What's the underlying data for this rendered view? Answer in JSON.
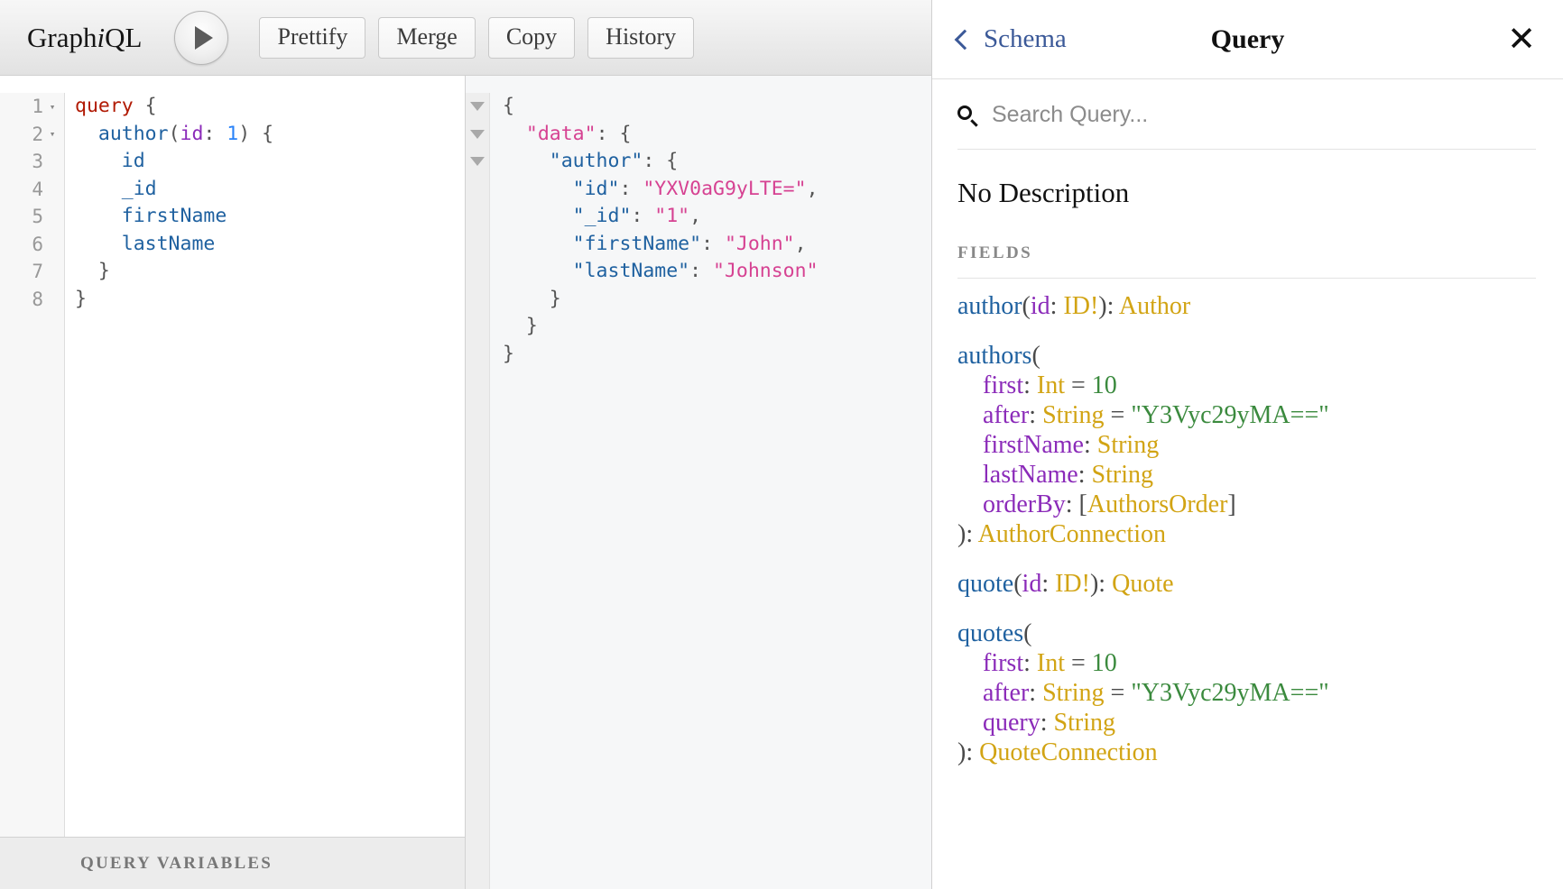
{
  "toolbar": {
    "logo_prefix": "Graph",
    "logo_i": "i",
    "logo_suffix": "QL",
    "execute_label": "▶",
    "buttons": [
      "Prettify",
      "Merge",
      "Copy",
      "History"
    ]
  },
  "query_editor": {
    "lines": [
      {
        "num": "1",
        "fold": "▾",
        "segments": [
          {
            "text": "query",
            "cls": "tok-kw"
          },
          {
            "text": " {",
            "cls": "tok-punc"
          }
        ]
      },
      {
        "num": "2",
        "fold": "▾",
        "segments": [
          {
            "text": "  ",
            "cls": "tok-punc"
          },
          {
            "text": "author",
            "cls": "tok-field"
          },
          {
            "text": "(",
            "cls": "tok-punc"
          },
          {
            "text": "id",
            "cls": "tok-arg"
          },
          {
            "text": ": ",
            "cls": "tok-punc"
          },
          {
            "text": "1",
            "cls": "tok-num"
          },
          {
            "text": ") {",
            "cls": "tok-punc"
          }
        ]
      },
      {
        "num": "3",
        "fold": "",
        "segments": [
          {
            "text": "    ",
            "cls": "tok-punc"
          },
          {
            "text": "id",
            "cls": "tok-field"
          }
        ]
      },
      {
        "num": "4",
        "fold": "",
        "segments": [
          {
            "text": "    ",
            "cls": "tok-punc"
          },
          {
            "text": "_id",
            "cls": "tok-field"
          }
        ]
      },
      {
        "num": "5",
        "fold": "",
        "segments": [
          {
            "text": "    ",
            "cls": "tok-punc"
          },
          {
            "text": "firstName",
            "cls": "tok-field"
          }
        ]
      },
      {
        "num": "6",
        "fold": "",
        "segments": [
          {
            "text": "    ",
            "cls": "tok-punc"
          },
          {
            "text": "lastName",
            "cls": "tok-field"
          }
        ]
      },
      {
        "num": "7",
        "fold": "",
        "segments": [
          {
            "text": "  }",
            "cls": "tok-punc"
          }
        ]
      },
      {
        "num": "8",
        "fold": "",
        "segments": [
          {
            "text": "}",
            "cls": "tok-punc"
          }
        ]
      }
    ],
    "query_variables_label": "QUERY VARIABLES"
  },
  "result": {
    "fold_count": 3,
    "lines": [
      [
        {
          "text": "{",
          "cls": "j-punc"
        }
      ],
      [
        {
          "text": "  ",
          "cls": "j-punc"
        },
        {
          "text": "\"data\"",
          "cls": "j-key-top"
        },
        {
          "text": ": {",
          "cls": "j-punc"
        }
      ],
      [
        {
          "text": "    ",
          "cls": "j-punc"
        },
        {
          "text": "\"author\"",
          "cls": "j-key"
        },
        {
          "text": ": {",
          "cls": "j-punc"
        }
      ],
      [
        {
          "text": "      ",
          "cls": "j-punc"
        },
        {
          "text": "\"id\"",
          "cls": "j-key"
        },
        {
          "text": ": ",
          "cls": "j-punc"
        },
        {
          "text": "\"YXV0aG9yLTE=\"",
          "cls": "j-str"
        },
        {
          "text": ",",
          "cls": "j-punc"
        }
      ],
      [
        {
          "text": "      ",
          "cls": "j-punc"
        },
        {
          "text": "\"_id\"",
          "cls": "j-key"
        },
        {
          "text": ": ",
          "cls": "j-punc"
        },
        {
          "text": "\"1\"",
          "cls": "j-str"
        },
        {
          "text": ",",
          "cls": "j-punc"
        }
      ],
      [
        {
          "text": "      ",
          "cls": "j-punc"
        },
        {
          "text": "\"firstName\"",
          "cls": "j-key"
        },
        {
          "text": ": ",
          "cls": "j-punc"
        },
        {
          "text": "\"John\"",
          "cls": "j-str"
        },
        {
          "text": ",",
          "cls": "j-punc"
        }
      ],
      [
        {
          "text": "      ",
          "cls": "j-punc"
        },
        {
          "text": "\"lastName\"",
          "cls": "j-key"
        },
        {
          "text": ": ",
          "cls": "j-punc"
        },
        {
          "text": "\"Johnson\"",
          "cls": "j-str"
        }
      ],
      [
        {
          "text": "    }",
          "cls": "j-punc"
        }
      ],
      [
        {
          "text": "  }",
          "cls": "j-punc"
        }
      ],
      [
        {
          "text": "}",
          "cls": "j-punc"
        }
      ]
    ]
  },
  "docs": {
    "back_label": "Schema",
    "title": "Query",
    "close_label": "✕",
    "search_placeholder": "Search Query...",
    "search_value": "",
    "description": "No Description",
    "fields_label": "FIELDS",
    "fields": [
      [
        {
          "text": "author",
          "cls": "f-name"
        },
        {
          "text": "(",
          "cls": "f-punc"
        },
        {
          "text": "id",
          "cls": "f-arg"
        },
        {
          "text": ": ",
          "cls": "f-punc"
        },
        {
          "text": "ID!",
          "cls": "f-type"
        },
        {
          "text": "): ",
          "cls": "f-punc"
        },
        {
          "text": "Author",
          "cls": "f-type"
        }
      ],
      [
        {
          "text": "authors",
          "cls": "f-name"
        },
        {
          "text": "(\n    ",
          "cls": "f-punc"
        },
        {
          "text": "first",
          "cls": "f-arg"
        },
        {
          "text": ": ",
          "cls": "f-punc"
        },
        {
          "text": "Int",
          "cls": "f-type"
        },
        {
          "text": " = ",
          "cls": "f-punc"
        },
        {
          "text": "10",
          "cls": "f-val"
        },
        {
          "text": "\n    ",
          "cls": "f-punc"
        },
        {
          "text": "after",
          "cls": "f-arg"
        },
        {
          "text": ": ",
          "cls": "f-punc"
        },
        {
          "text": "String",
          "cls": "f-type"
        },
        {
          "text": " = ",
          "cls": "f-punc"
        },
        {
          "text": "\"Y3Vyc29yMA==\"",
          "cls": "f-val"
        },
        {
          "text": "\n    ",
          "cls": "f-punc"
        },
        {
          "text": "firstName",
          "cls": "f-arg"
        },
        {
          "text": ": ",
          "cls": "f-punc"
        },
        {
          "text": "String",
          "cls": "f-type"
        },
        {
          "text": "\n    ",
          "cls": "f-punc"
        },
        {
          "text": "lastName",
          "cls": "f-arg"
        },
        {
          "text": ": ",
          "cls": "f-punc"
        },
        {
          "text": "String",
          "cls": "f-type"
        },
        {
          "text": "\n    ",
          "cls": "f-punc"
        },
        {
          "text": "orderBy",
          "cls": "f-arg"
        },
        {
          "text": ": [",
          "cls": "f-punc"
        },
        {
          "text": "AuthorsOrder",
          "cls": "f-type"
        },
        {
          "text": "]\n): ",
          "cls": "f-punc"
        },
        {
          "text": "AuthorConnection",
          "cls": "f-type"
        }
      ],
      [
        {
          "text": "quote",
          "cls": "f-name"
        },
        {
          "text": "(",
          "cls": "f-punc"
        },
        {
          "text": "id",
          "cls": "f-arg"
        },
        {
          "text": ": ",
          "cls": "f-punc"
        },
        {
          "text": "ID!",
          "cls": "f-type"
        },
        {
          "text": "): ",
          "cls": "f-punc"
        },
        {
          "text": "Quote",
          "cls": "f-type"
        }
      ],
      [
        {
          "text": "quotes",
          "cls": "f-name"
        },
        {
          "text": "(\n    ",
          "cls": "f-punc"
        },
        {
          "text": "first",
          "cls": "f-arg"
        },
        {
          "text": ": ",
          "cls": "f-punc"
        },
        {
          "text": "Int",
          "cls": "f-type"
        },
        {
          "text": " = ",
          "cls": "f-punc"
        },
        {
          "text": "10",
          "cls": "f-val"
        },
        {
          "text": "\n    ",
          "cls": "f-punc"
        },
        {
          "text": "after",
          "cls": "f-arg"
        },
        {
          "text": ": ",
          "cls": "f-punc"
        },
        {
          "text": "String",
          "cls": "f-type"
        },
        {
          "text": " = ",
          "cls": "f-punc"
        },
        {
          "text": "\"Y3Vyc29yMA==\"",
          "cls": "f-val"
        },
        {
          "text": "\n    ",
          "cls": "f-punc"
        },
        {
          "text": "query",
          "cls": "f-arg"
        },
        {
          "text": ": ",
          "cls": "f-punc"
        },
        {
          "text": "String",
          "cls": "f-type"
        },
        {
          "text": "\n): ",
          "cls": "f-punc"
        },
        {
          "text": "QuoteConnection",
          "cls": "f-type"
        }
      ]
    ]
  }
}
